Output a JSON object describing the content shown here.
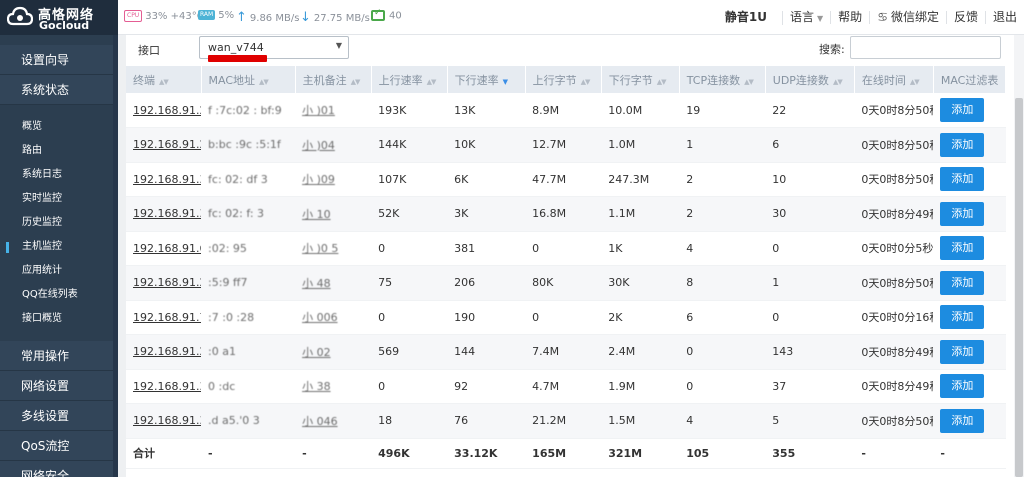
{
  "brand": {
    "name_cn": "高恪网络",
    "name_en": "Gocloud"
  },
  "status": {
    "cpu_chip": "CPU",
    "cpu": "33% +43°C",
    "ram_chip": "RAM",
    "ram": "5%",
    "upload": "9.86 MB/s",
    "download": "27.75 MB/s",
    "online": "40"
  },
  "top_nav": {
    "mute": "静音1U",
    "language": "语言",
    "help": "帮助",
    "wechat": "微信绑定",
    "feedback": "反馈",
    "logout": "退出"
  },
  "sidebar": {
    "sections": [
      {
        "label": "设置向导"
      },
      {
        "label": "系统状态"
      }
    ],
    "sub_items": [
      "概览",
      "路由",
      "系统日志",
      "实时监控",
      "历史监控",
      "主机监控",
      "应用统计",
      "QQ在线列表",
      "接口概览"
    ],
    "active_sub": "主机监控",
    "bottom_sections": [
      {
        "label": "常用操作"
      },
      {
        "label": "网络设置"
      },
      {
        "label": "多线设置"
      },
      {
        "label": "QoS流控"
      },
      {
        "label": "网络安全"
      }
    ]
  },
  "filter": {
    "interface_label": "接口",
    "interface_value": "wan_v744",
    "search_label": "搜索:",
    "search_value": ""
  },
  "table": {
    "columns": [
      "终端",
      "MAC地址",
      "主机备注",
      "上行速率",
      "下行速率",
      "上行字节",
      "下行字节",
      "TCP连接数",
      "UDP连接数",
      "在线时间",
      "MAC过滤表"
    ],
    "sort_column": "下行速率",
    "add_label": "添加",
    "rows": [
      {
        "ip": "192.168.91.28",
        "mac": "f :7c:02 : bf:9",
        "host": "小 )01",
        "up_rate": "193K",
        "down_rate": "13K",
        "up_bytes": "8.9M",
        "down_bytes": "10.0M",
        "tcp": "19",
        "udp": "22",
        "online": "0天0时8分50秒"
      },
      {
        "ip": "192.168.91.23",
        "mac": "b:bc :9c :5:1f",
        "host": "小 )04",
        "up_rate": "144K",
        "down_rate": "10K",
        "up_bytes": "12.7M",
        "down_bytes": "1.0M",
        "tcp": "1",
        "udp": "6",
        "online": "0天0时8分50秒"
      },
      {
        "ip": "192.168.91.32",
        "mac": "fc: 02: df 3",
        "host": "小 )09",
        "up_rate": "107K",
        "down_rate": "6K",
        "up_bytes": "47.7M",
        "down_bytes": "247.3M",
        "tcp": "2",
        "udp": "10",
        "online": "0天0时8分50秒"
      },
      {
        "ip": "192.168.91.33",
        "mac": "fc: 02: f: 3",
        "host": "小 10",
        "up_rate": "52K",
        "down_rate": "3K",
        "up_bytes": "16.8M",
        "down_bytes": "1.1M",
        "tcp": "2",
        "udp": "30",
        "online": "0天0时8分49秒"
      },
      {
        "ip": "192.168.91.6",
        "mac": ":02: 95",
        "host": "小 )0 5",
        "up_rate": "0",
        "down_rate": "381",
        "up_bytes": "0",
        "down_bytes": "1K",
        "tcp": "4",
        "udp": "0",
        "online": "0天0时0分5秒"
      },
      {
        "ip": "192.168.91.22",
        "mac": ":5:9 ff7",
        "host": "小 48",
        "up_rate": "75",
        "down_rate": "206",
        "up_bytes": "80K",
        "down_bytes": "30K",
        "tcp": "8",
        "udp": "1",
        "online": "0天0时8分50秒"
      },
      {
        "ip": "192.168.91.7",
        "mac": ":7 :0 :28",
        "host": "小 006",
        "up_rate": "0",
        "down_rate": "190",
        "up_bytes": "0",
        "down_bytes": "2K",
        "tcp": "6",
        "udp": "0",
        "online": "0天0时0分16秒"
      },
      {
        "ip": "192.168.91.27",
        "mac": ":0 a1",
        "host": "小 02",
        "up_rate": "569",
        "down_rate": "144",
        "up_bytes": "7.4M",
        "down_bytes": "2.4M",
        "tcp": "0",
        "udp": "143",
        "online": "0天0时8分49秒"
      },
      {
        "ip": "192.168.91.36",
        "mac": "0 :dc",
        "host": "小 38",
        "up_rate": "0",
        "down_rate": "92",
        "up_bytes": "4.7M",
        "down_bytes": "1.9M",
        "tcp": "0",
        "udp": "37",
        "online": "0天0时8分49秒"
      },
      {
        "ip": "192.168.91.35",
        "mac": ".d a5.'0 3",
        "host": "小 046",
        "up_rate": "18",
        "down_rate": "76",
        "up_bytes": "21.2M",
        "down_bytes": "1.5M",
        "tcp": "4",
        "udp": "5",
        "online": "0天0时8分50秒"
      }
    ],
    "total": {
      "label": "合计",
      "mac": "-",
      "host": "-",
      "up_rate": "496K",
      "down_rate": "33.12K",
      "up_bytes": "165M",
      "down_bytes": "321M",
      "tcp": "105",
      "udp": "355",
      "online": "-",
      "filter": "-"
    }
  },
  "colors": {
    "sidebar_bg": "#2c3e50",
    "header_bg": "#e6ebf1",
    "button": "#1d8ce0",
    "red_mark": "#e00000"
  }
}
